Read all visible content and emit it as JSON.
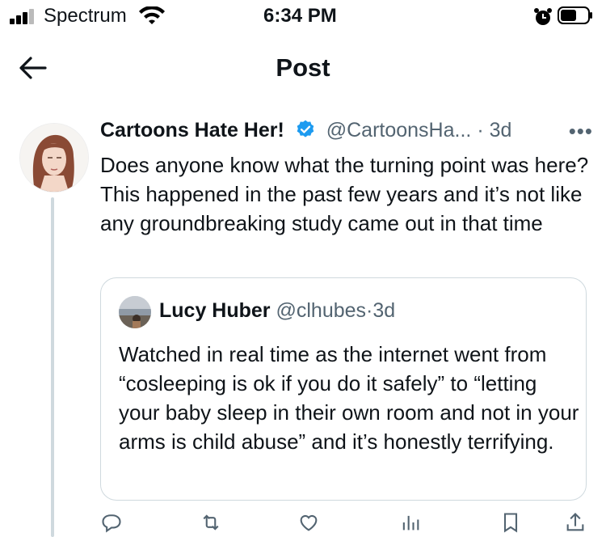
{
  "status_bar": {
    "carrier": "Spectrum",
    "time": "6:34 PM"
  },
  "header": {
    "title": "Post"
  },
  "post": {
    "author_name": "Cartoons Hate Her!",
    "handle": "@CartoonsHa...",
    "separator": "·",
    "time": "3d",
    "more_label": "•••",
    "text": "Does anyone know what the turning point was here? This happened in the past few years and it’s not like any groundbreaking study came out in that time"
  },
  "quote": {
    "author_name": "Lucy Huber",
    "handle": "@clhubes",
    "separator": "·",
    "time": "3d",
    "text": "Watched in real time as the internet went from “cosleeping is ok if you do it safely” to “letting your baby sleep in their own room and not in your arms is child abuse” and it’s honestly terrifying."
  },
  "actions": {
    "replies": "",
    "reposts": "",
    "likes": "",
    "views": ""
  },
  "icons": {
    "back": "arrow-left-icon",
    "verified": "verified-badge-icon",
    "more": "more-icon",
    "reply": "reply-icon",
    "repost": "repost-icon",
    "like": "heart-icon",
    "views": "views-icon",
    "bookmark": "bookmark-icon",
    "share": "share-icon"
  },
  "colors": {
    "verified_blue": "#1d9bf0",
    "secondary_text": "#536471",
    "border": "#cfd9de"
  }
}
